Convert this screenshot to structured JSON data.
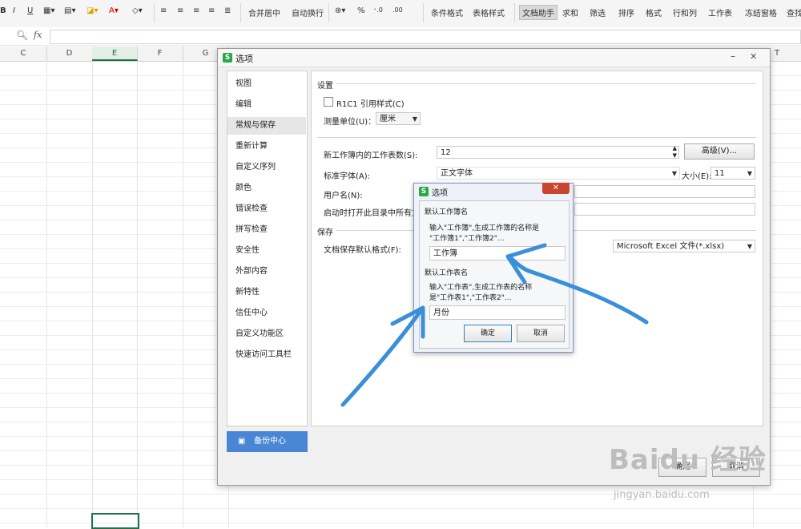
{
  "ribbon": {
    "font_buttons": [
      "B",
      "I",
      "U"
    ],
    "merge_center": "合并居中",
    "wrap_text": "自动换行",
    "percent": "%",
    "cond_format": "条件格式",
    "table_style": "表格样式",
    "doc_helper": "文档助手",
    "sum": "求和",
    "filter": "筛选",
    "sort": "排序",
    "format": "格式",
    "row_col": "行和列",
    "worksheet": "工作表",
    "freeze": "冻结窗格",
    "find": "查找"
  },
  "formula_bar": {
    "fx": "fx",
    "value": ""
  },
  "columns": [
    "C",
    "D",
    "E",
    "F",
    "G",
    "T"
  ],
  "options_dialog": {
    "title": "选项",
    "nav": [
      "视图",
      "编辑",
      "常规与保存",
      "重新计算",
      "自定义序列",
      "颜色",
      "错误检查",
      "拼写检查",
      "安全性",
      "外部内容",
      "新特性",
      "信任中心",
      "自定义功能区",
      "快速访问工具栏"
    ],
    "selected_nav": "常规与保存",
    "backup_center": "备份中心",
    "settings_header": "设置",
    "r1c1": "R1C1 引用样式(C)",
    "unit_label": "测量单位(U)：",
    "unit_value": "厘米",
    "sheets_label": "新工作簿内的工作表数(S):",
    "sheets_value": "12",
    "advanced_button": "高级(V)...",
    "font_label": "标准字体(A):",
    "font_value": "正文字体",
    "size_label": "大小(E):",
    "size_value": "11",
    "username_label": "用户名(N):",
    "startup_label": "启动时打开此目录中所有文",
    "save_header": "保存",
    "save_format_label": "文档保存默认格式(F):",
    "save_format_value": "Microsoft Excel 文件(*.xlsx)",
    "ok_button": "确定",
    "cancel_button": "取消"
  },
  "sub_dialog": {
    "title": "选项",
    "close": "✕",
    "workbook_group": "默认工作簿名",
    "workbook_desc_1": "输入\"工作簿\",生成工作簿的名称是",
    "workbook_desc_2": "\"工作簿1\",\"工作簿2\"...",
    "workbook_value": "工作簿",
    "sheet_group": "默认工作表名",
    "sheet_desc_1": "输入\"工作表\",生成工作表的名称",
    "sheet_desc_2": "是\"工作表1\",\"工作表2\"...",
    "sheet_value": "月份",
    "ok": "确定",
    "cancel": "取消"
  },
  "watermark": {
    "brand": "Baidu 经验",
    "url": "jingyan.baidu.com"
  },
  "colors": {
    "accent_green": "#217346",
    "nav_blue": "#4a86d6",
    "annotation_blue": "#3b8fd6",
    "close_red": "#c8452f"
  }
}
